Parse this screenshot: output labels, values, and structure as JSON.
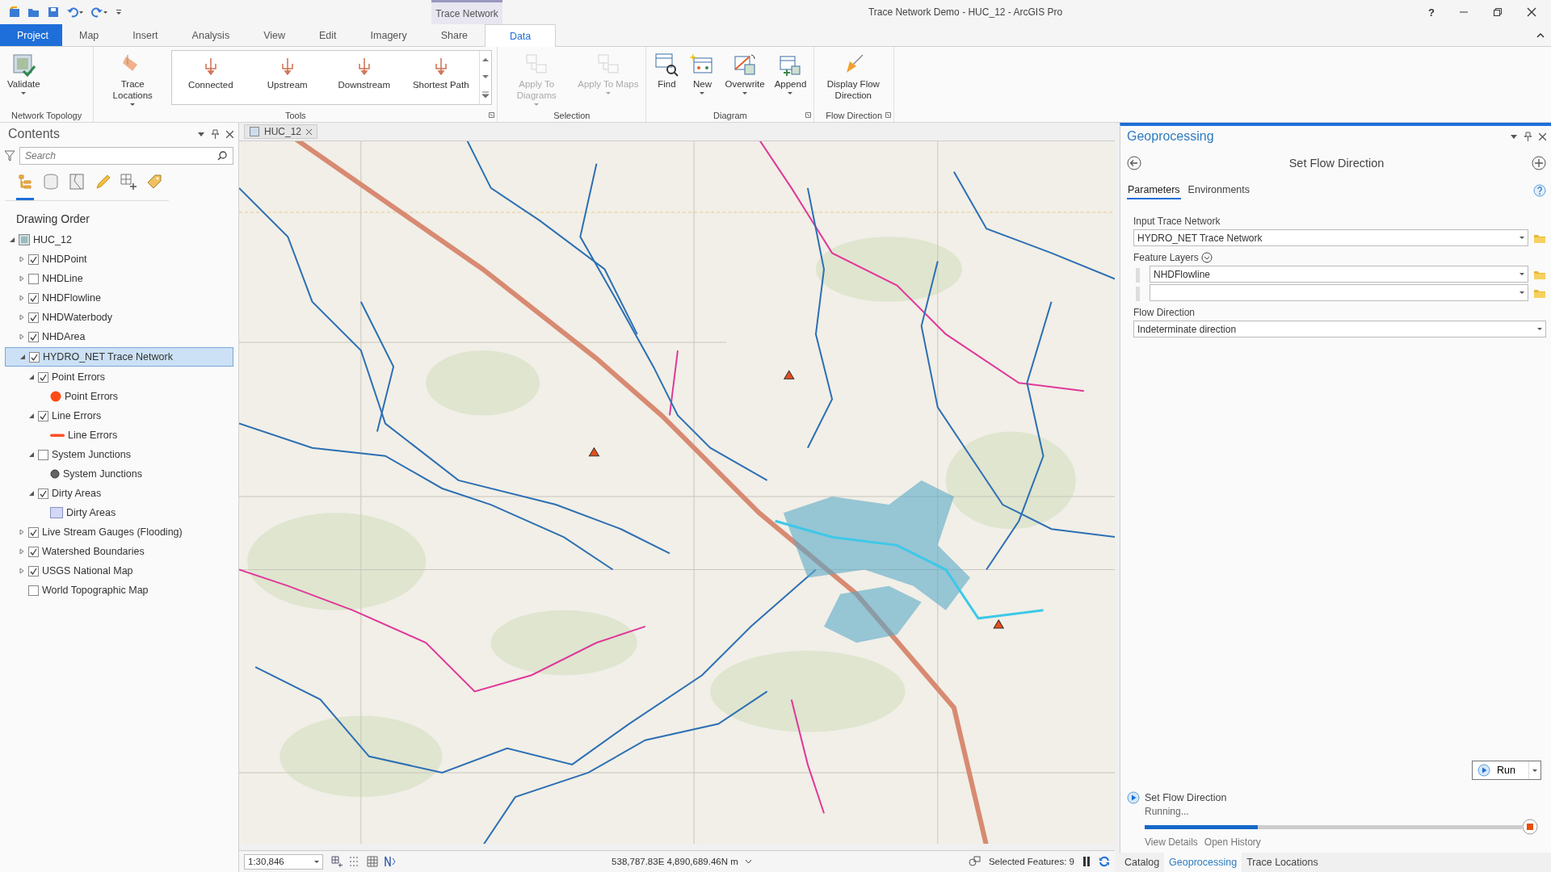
{
  "window": {
    "title": "Trace Network Demo - HUC_12 - ArcGIS Pro",
    "help": "?"
  },
  "ribbon": {
    "contextual_tab": "Trace Network",
    "tabs": [
      {
        "label": "Project",
        "kind": "backstage",
        "selected": false
      },
      {
        "label": "Map",
        "kind": "tab",
        "selected": false
      },
      {
        "label": "Insert",
        "kind": "tab",
        "selected": false
      },
      {
        "label": "Analysis",
        "kind": "tab",
        "selected": false
      },
      {
        "label": "View",
        "kind": "tab",
        "selected": false
      },
      {
        "label": "Edit",
        "kind": "tab",
        "selected": false
      },
      {
        "label": "Imagery",
        "kind": "tab",
        "selected": false
      },
      {
        "label": "Share",
        "kind": "tab",
        "selected": false
      },
      {
        "label": "Data",
        "kind": "tab",
        "selected": true
      }
    ],
    "groups": [
      {
        "label": "Network Topology",
        "launcher": false,
        "buttons": [
          {
            "label": "Validate",
            "dropdown": true,
            "disabled": false
          }
        ]
      },
      {
        "label": "Tools",
        "launcher": true,
        "buttons": [
          {
            "label": "Trace Locations",
            "dropdown": true,
            "disabled": false
          }
        ],
        "gallery": [
          "Connected",
          "Upstream",
          "Downstream",
          "Shortest Path"
        ]
      },
      {
        "label": "Selection",
        "launcher": false,
        "buttons": [
          {
            "label": "Apply To Diagrams",
            "dropdown": true,
            "disabled": true
          },
          {
            "label": "Apply To Maps",
            "dropdown": true,
            "disabled": true
          }
        ]
      },
      {
        "label": "Diagram",
        "launcher": true,
        "buttons": [
          {
            "label": "Find",
            "dropdown": false,
            "disabled": false
          },
          {
            "label": "New",
            "dropdown": true,
            "disabled": false
          },
          {
            "label": "Overwrite",
            "dropdown": true,
            "disabled": false
          },
          {
            "label": "Append",
            "dropdown": true,
            "disabled": false
          }
        ]
      },
      {
        "label": "Flow Direction",
        "launcher": true,
        "buttons": [
          {
            "label": "Display Flow Direction",
            "dropdown": false,
            "disabled": false
          }
        ]
      }
    ]
  },
  "contents": {
    "title": "Contents",
    "search_placeholder": "Search",
    "view_tabs": [
      {
        "selected": true
      },
      {
        "selected": false
      },
      {
        "selected": false
      },
      {
        "selected": false
      },
      {
        "selected": false
      },
      {
        "selected": false
      }
    ],
    "heading": "Drawing Order",
    "items": [
      {
        "label": "HUC_12",
        "kind": "map",
        "expanded": true,
        "selected": false,
        "children": [
          {
            "label": "NHDPoint",
            "kind": "layer",
            "checked": true,
            "expanded": false,
            "selected": false
          },
          {
            "label": "NHDLine",
            "kind": "layer",
            "checked": false,
            "expanded": false,
            "selected": false
          },
          {
            "label": "NHDFlowline",
            "kind": "layer",
            "checked": true,
            "expanded": false,
            "selected": false
          },
          {
            "label": "NHDWaterbody",
            "kind": "layer",
            "checked": true,
            "expanded": false,
            "selected": false
          },
          {
            "label": "NHDArea",
            "kind": "layer",
            "checked": true,
            "expanded": false,
            "selected": false
          },
          {
            "label": "HYDRO_NET Trace Network",
            "kind": "layer",
            "checked": true,
            "expanded": true,
            "selected": true,
            "children": [
              {
                "label": "Point Errors",
                "kind": "layer",
                "checked": true,
                "expanded": true,
                "selected": false,
                "children": [
                  {
                    "label": "Point Errors",
                    "kind": "dot",
                    "color": "#ff4a12",
                    "selected": false
                  }
                ]
              },
              {
                "label": "Line Errors",
                "kind": "layer",
                "checked": true,
                "expanded": true,
                "selected": false,
                "children": [
                  {
                    "label": "Line Errors",
                    "kind": "stroke",
                    "color": "#ff5024",
                    "selected": false
                  }
                ]
              },
              {
                "label": "System Junctions",
                "kind": "layer",
                "checked": false,
                "expanded": true,
                "selected": false,
                "children": [
                  {
                    "label": "System Junctions",
                    "kind": "marker",
                    "color": "#646464",
                    "selected": false
                  }
                ]
              },
              {
                "label": "Dirty Areas",
                "kind": "layer",
                "checked": true,
                "expanded": true,
                "selected": false,
                "children": [
                  {
                    "label": "Dirty Areas",
                    "kind": "patch",
                    "color": "#d4d8f6",
                    "selected": false
                  }
                ]
              }
            ]
          },
          {
            "label": "Live Stream Gauges (Flooding)",
            "kind": "layer",
            "checked": true,
            "expanded": false,
            "selected": false
          },
          {
            "label": "Watershed Boundaries",
            "kind": "layer",
            "checked": true,
            "expanded": false,
            "selected": false
          },
          {
            "label": "USGS National Map",
            "kind": "layer",
            "checked": true,
            "expanded": false,
            "selected": false
          },
          {
            "label": "World Topographic Map",
            "kind": "layer",
            "checked": false,
            "selected": false
          }
        ]
      }
    ]
  },
  "map": {
    "tab": "HUC_12",
    "scale": "1:30,846",
    "coordinates": "538,787.83E 4,890,689.46N m",
    "selected_features": "Selected Features: 9"
  },
  "geoprocessing": {
    "title": "Geoprocessing",
    "tool": "Set Flow Direction",
    "tabs": [
      {
        "label": "Parameters",
        "selected": true
      },
      {
        "label": "Environments",
        "selected": false
      }
    ],
    "parameters": [
      {
        "label": "Input Trace Network",
        "kind": "single",
        "browse": true,
        "values": [
          "HYDRO_NET Trace Network"
        ]
      },
      {
        "label": "Feature Layers",
        "kind": "multi",
        "browse": true,
        "values": [
          "NHDFlowline"
        ]
      },
      {
        "label": "Flow Direction",
        "kind": "single",
        "browse": false,
        "values": [
          "Indeterminate direction"
        ]
      }
    ],
    "run": "Run",
    "progress": {
      "tool": "Set Flow Direction",
      "status": "Running...",
      "level": 0.3,
      "links": [
        "View Details",
        "Open History"
      ]
    },
    "bottom_tabs": [
      {
        "label": "Catalog",
        "selected": false
      },
      {
        "label": "Geoprocessing",
        "selected": true
      },
      {
        "label": "Trace Locations",
        "selected": false
      }
    ]
  }
}
